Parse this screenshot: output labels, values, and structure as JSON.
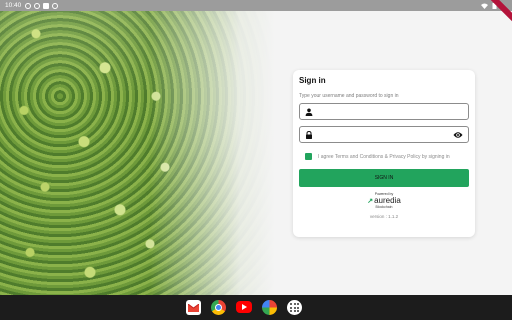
{
  "status": {
    "time": "10:40"
  },
  "login": {
    "title": "Sign in",
    "subtitle": "Type your username and password to sign in",
    "username_value": "",
    "password_value": "",
    "agree_text": "I agree Terms and Conditions & Privacy Policy by signing in",
    "signin_label": "SIGN IN",
    "powered_by": "Powered by",
    "brand_name": "auredia",
    "brand_sub": "Blockchain",
    "version": "version : 1.1.2"
  },
  "colors": {
    "accent": "#22a45d",
    "card": "#ffffff",
    "taskbar": "#1c1c1c"
  },
  "taskbar": {
    "apps": [
      "gmail-icon",
      "chrome-icon",
      "youtube-icon",
      "photos-icon",
      "app-drawer-icon"
    ]
  }
}
